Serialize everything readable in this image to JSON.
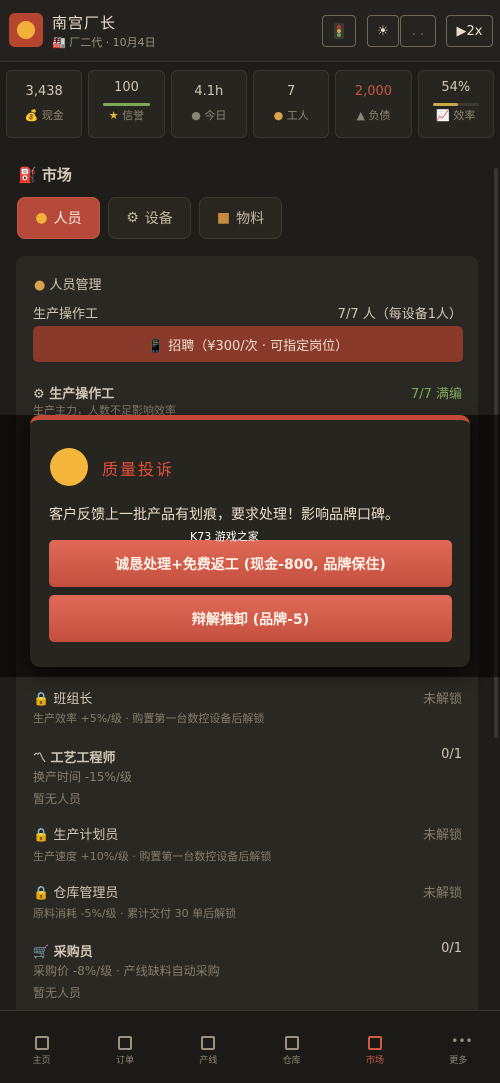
{
  "header": {
    "title": "南宫厂长",
    "subtitle": "🏭 厂二代 · 10月4日",
    "speed": "▶2x",
    "btn_b": "☀",
    "btn_c": ". ."
  },
  "stats": [
    {
      "value": "3,438",
      "label": "现金",
      "icon": "money-bag-icon"
    },
    {
      "value": "100",
      "label": "信誉",
      "icon": "star-icon",
      "fill": 1.0,
      "color": "#7da857"
    },
    {
      "value": "4.1h",
      "label": "今日",
      "icon": "clock-icon"
    },
    {
      "value": "7",
      "label": "工人",
      "icon": "worker-icon"
    },
    {
      "value": "2,000",
      "label": "负债",
      "icon": "bank-icon",
      "value_color": "#c05a43"
    },
    {
      "value": "54%",
      "label": "效率",
      "icon": "chart-icon",
      "fill": 0.54,
      "color": "#c9a84a"
    }
  ],
  "market": {
    "title": "市场",
    "tabs": [
      {
        "label": "人员",
        "icon": "worker-icon",
        "active": true
      },
      {
        "label": "设备",
        "icon": "gear-icon",
        "active": false
      },
      {
        "label": "物料",
        "icon": "box-icon",
        "active": false
      }
    ],
    "staff": {
      "heading": "人员管理",
      "role_label": "生产操作工",
      "role_count": "7/7 人（每设备1人）",
      "recruit": "📱 招聘（¥300/次 · 可指定岗位）",
      "positions": [
        {
          "name": "生产操作工",
          "status": "7/7 满编",
          "desc": "生产主力，人数不足影响效率",
          "locked": false
        },
        {
          "name": "班组长",
          "status": "未解锁",
          "desc": "生产效率 +5%/级 · 购置第一台数控设备后解锁",
          "locked": true
        },
        {
          "name": "工艺工程师",
          "status": "0/1",
          "desc": "换产时间 -15%/级",
          "extra": "暂无人员",
          "locked": false
        },
        {
          "name": "生产计划员",
          "status": "未解锁",
          "desc": "生产速度 +10%/级 · 购置第一台数控设备后解锁",
          "locked": true
        },
        {
          "name": "仓库管理员",
          "status": "未解锁",
          "desc": "原料消耗 -5%/级 · 累计交付 30 单后解锁",
          "locked": true
        },
        {
          "name": "采购员",
          "status": "0/1",
          "desc": "采购价 -8%/级 · 产线缺料自动采购",
          "extra": "暂无人员",
          "locked": false
        }
      ]
    }
  },
  "modal": {
    "title": "质量投诉",
    "message": "客户反馈上一批产品有划痕，要求处理！影响品牌口碑。",
    "option_a": "诚恳处理+免费返工 (现金-800, 品牌保住)",
    "option_b": "辩解推卸 (品牌-5)",
    "watermark": "K73 游戏之家"
  },
  "nav": [
    {
      "label": "主页",
      "active": false
    },
    {
      "label": "订单",
      "active": false
    },
    {
      "label": "产线",
      "active": false
    },
    {
      "label": "仓库",
      "active": false
    },
    {
      "label": "市场",
      "active": true
    },
    {
      "label": "更多",
      "active": false
    }
  ]
}
